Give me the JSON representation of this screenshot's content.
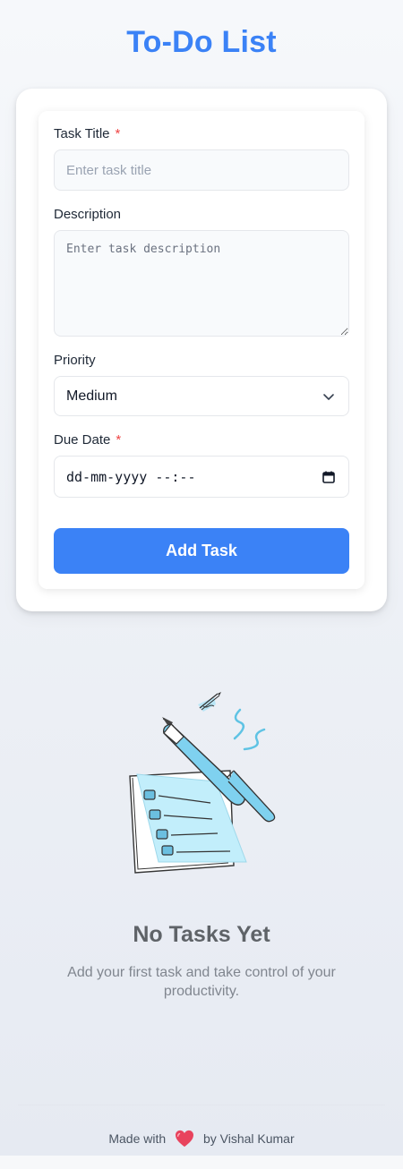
{
  "header": {
    "title": "To-Do List"
  },
  "form": {
    "title_field": {
      "label": "Task Title",
      "required_mark": "*",
      "placeholder": "Enter task title",
      "value": ""
    },
    "description_field": {
      "label": "Description",
      "placeholder": "Enter task description",
      "value": ""
    },
    "priority_field": {
      "label": "Priority",
      "selected": "Medium"
    },
    "due_date_field": {
      "label": "Due Date",
      "required_mark": "*",
      "value": "dd-mm-yyyy --:--"
    },
    "submit_label": "Add Task"
  },
  "empty_state": {
    "title": "No Tasks Yet",
    "message": "Add your first task and take control of your productivity.",
    "illustration_icon": "notebook-pen-illustration"
  },
  "footer": {
    "made_with": "Made with",
    "heart_icon": "heart-icon",
    "by": "by Vishal Kumar"
  },
  "colors": {
    "accent": "#3b82f6",
    "required": "#ef4444",
    "heart": "#e8435d"
  }
}
